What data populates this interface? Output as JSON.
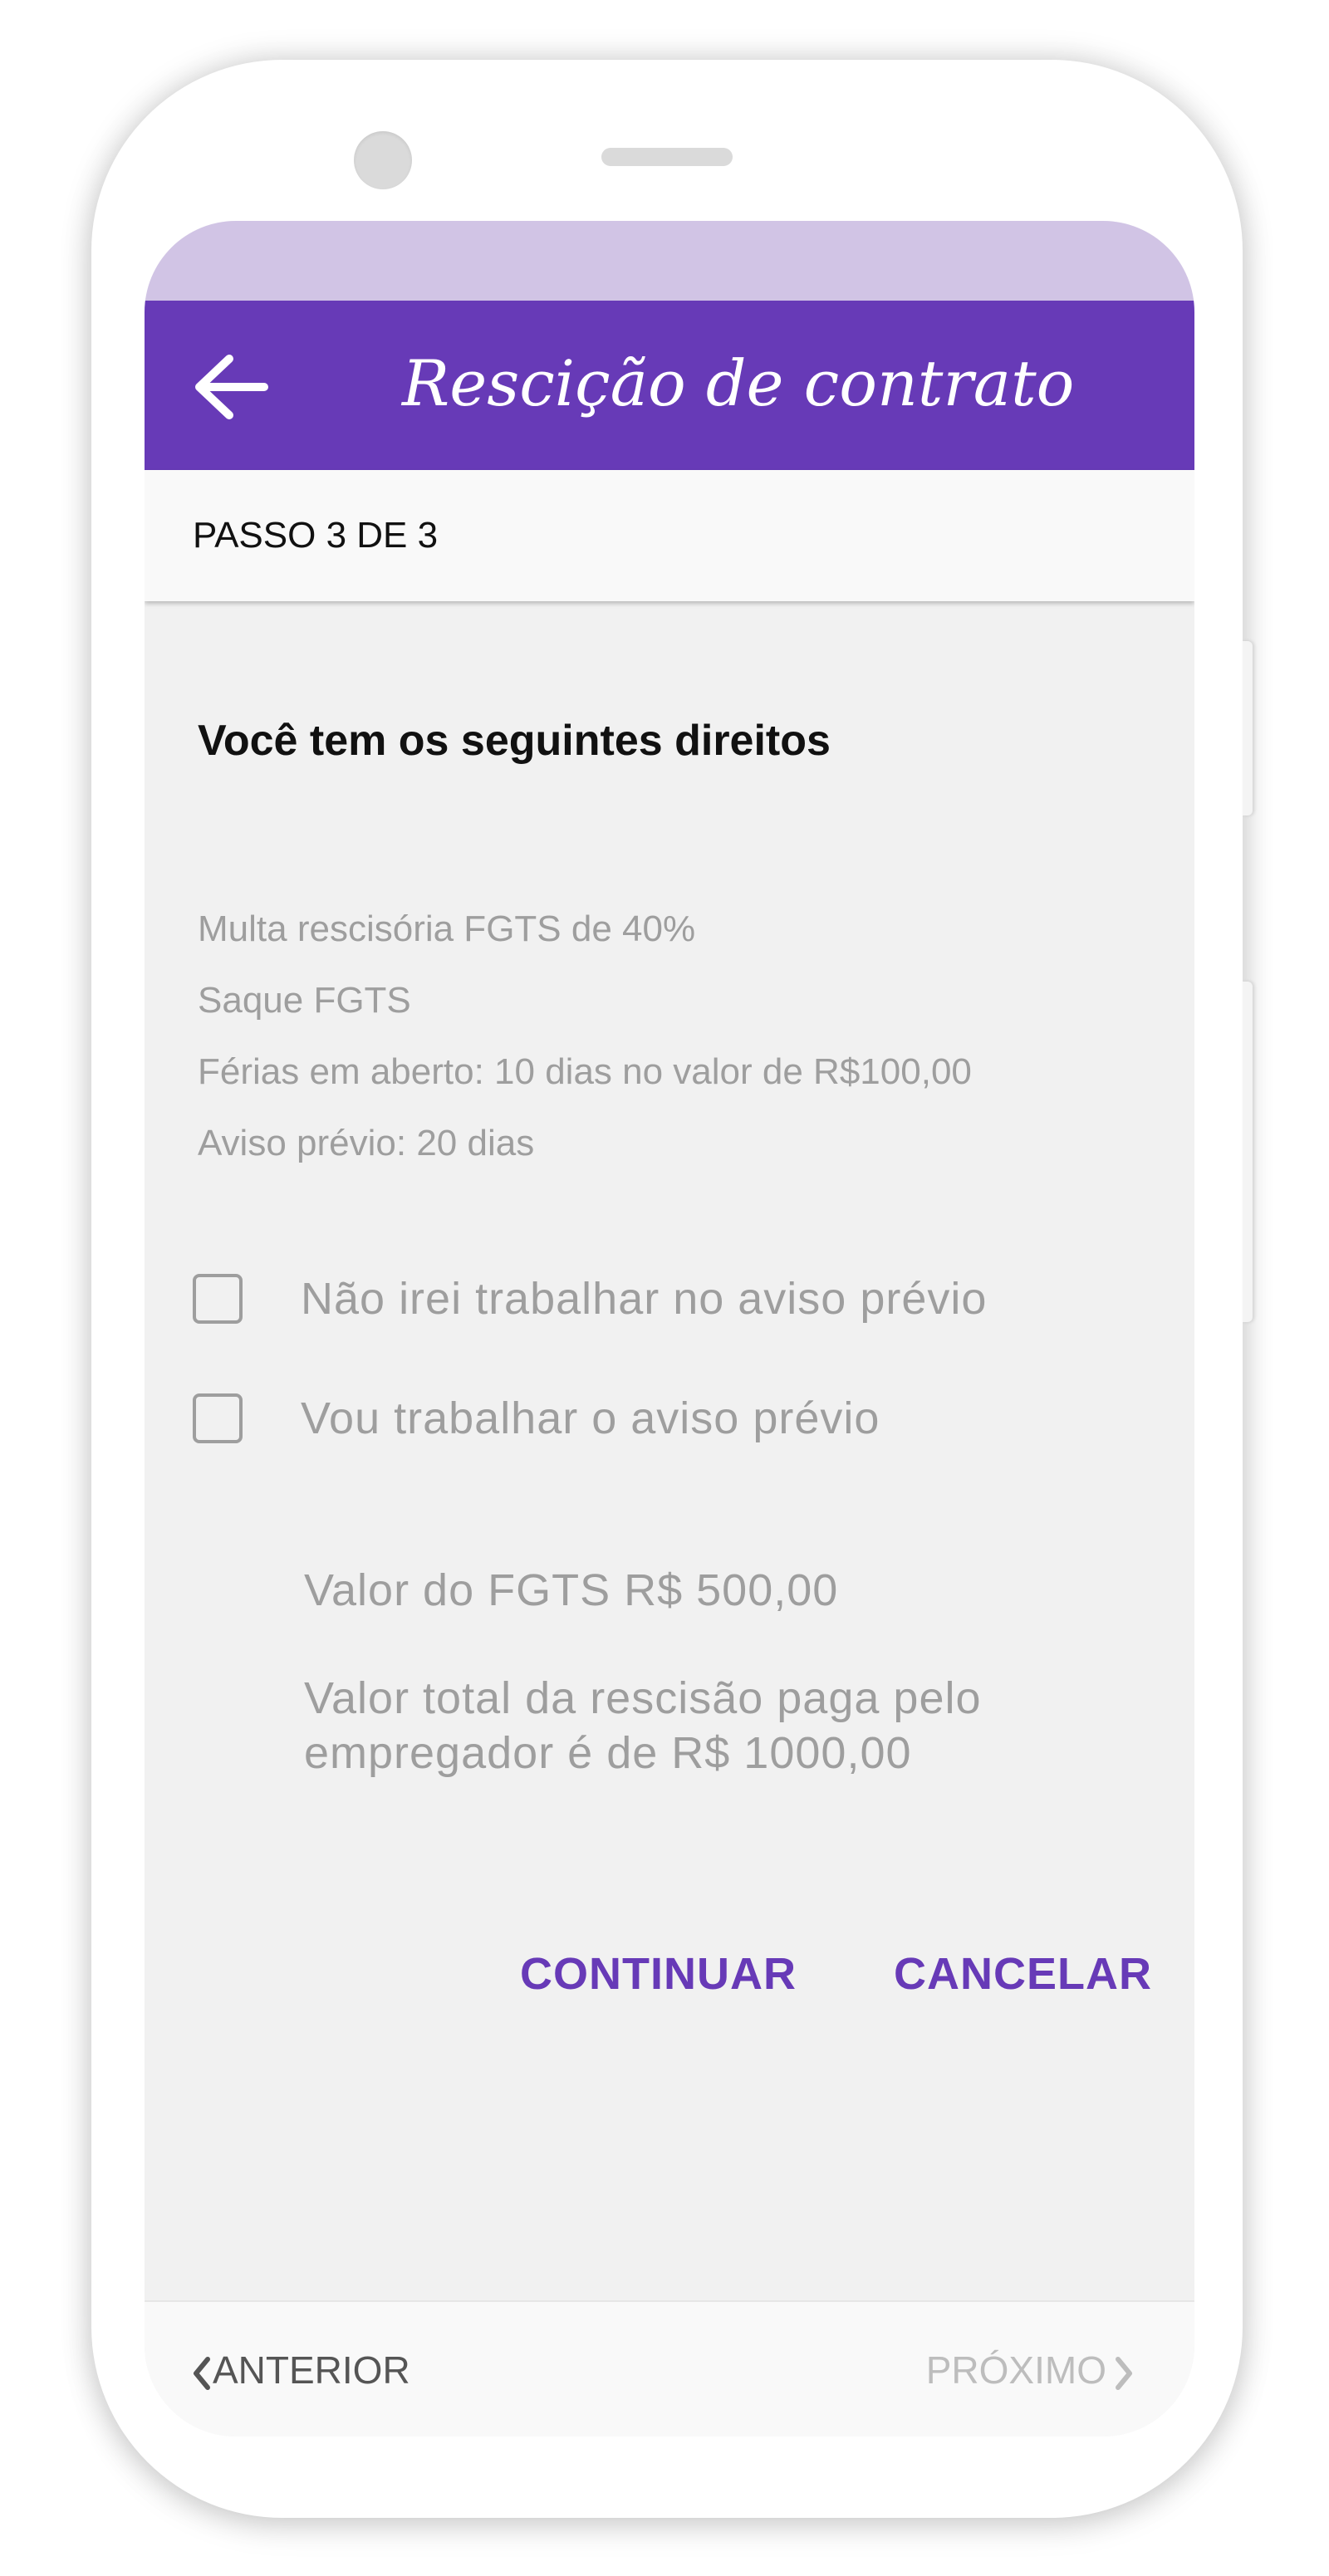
{
  "app_bar": {
    "title": "Rescição de contrato",
    "back_icon": "arrow-left-icon",
    "color": "#673ab7",
    "status_bar_color": "#d1c4e5"
  },
  "stepper": {
    "label": "PASSO 3 DE 3"
  },
  "content": {
    "heading": "Você tem os seguintes direitos",
    "rights": [
      "Multa rescisória FGTS de 40%",
      "Saque FGTS",
      "Férias em aberto: 10 dias no valor de R$100,00",
      "Aviso prévio: 20 dias"
    ],
    "options": [
      {
        "label": "Não irei trabalhar no aviso prévio",
        "checked": false
      },
      {
        "label": "Vou trabalhar o aviso prévio",
        "checked": false
      }
    ],
    "fgts_value": "Valor do FGTS R$ 500,00",
    "total_value_line1": "Valor total da rescisão paga pelo",
    "total_value_line2": "empregador é de R$ 1000,00"
  },
  "actions": {
    "continue_label": "CONTINUAR",
    "cancel_label": "CANCELAR",
    "accent": "#673ab7"
  },
  "bottom_nav": {
    "prev_label": "ANTERIOR",
    "next_label": "PRÓXIMO",
    "prev_icon": "chevron-left-icon",
    "next_icon": "chevron-right-icon"
  }
}
